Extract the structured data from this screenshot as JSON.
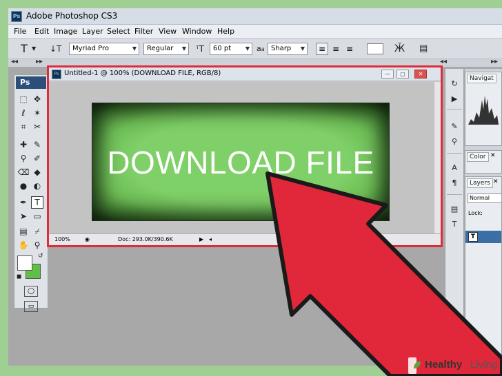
{
  "app": {
    "logo": "Ps",
    "title": "Adobe Photoshop CS3"
  },
  "menu": [
    "File",
    "Edit",
    "Image",
    "Layer",
    "Select",
    "Filter",
    "View",
    "Window",
    "Help"
  ],
  "options": {
    "font_family": "Myriad Pro",
    "font_style": "Regular",
    "font_size": "60 pt",
    "aa_label": "a",
    "aa_label_sub": "a",
    "antialias": "Sharp"
  },
  "tools": {
    "tab": "Ps"
  },
  "document": {
    "icon": "Ps",
    "title": "Untitled-1 @ 100% (DOWNLOAD FILE, RGB/8)",
    "zoom": "100%",
    "doc_size": "Doc: 293.0K/390.6K",
    "canvas_text": "DOWNLOAD FILE"
  },
  "panels": {
    "navigator": "Navigat",
    "color": "Color",
    "layers": "Layers",
    "blend_mode": "Normal",
    "lock": "Lock:",
    "layer_thumb": "T"
  },
  "colors": {
    "foreground": "#ffffff",
    "background": "#5fbf46",
    "highlight_border": "#e02b3a",
    "arrow": "#e0283a",
    "button_green": "#7fd068"
  },
  "watermark": {
    "brand1": "Healthy",
    "brand2": "Living"
  }
}
